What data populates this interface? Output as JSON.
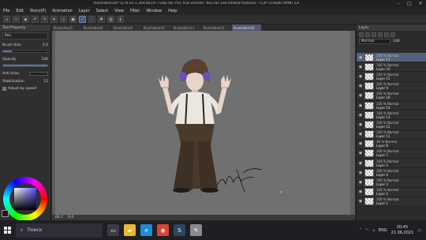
{
  "window": {
    "title": "Illustration16* (176.42 x 264.81cm 72dpi 66.7%)  Trial version: You can use limited features - CLIP STUDIO PAINT EX",
    "controls": [
      "–",
      "□",
      "✕"
    ]
  },
  "menu": [
    "File",
    "Edit",
    "Story(P)",
    "Animation",
    "Layer",
    "Select",
    "View",
    "Filter",
    "Window",
    "Help"
  ],
  "command_bar": [
    "new",
    "open",
    "save",
    "undo",
    "redo",
    "clear",
    "trans",
    "fill",
    "snap1",
    "snap2",
    "snap3",
    "ruler",
    "guide"
  ],
  "tool_property": {
    "header": "Tool Property",
    "brush_name": "Pen",
    "brush_size_label": "Brush Size",
    "brush_size_value": "5.0",
    "opacity_label": "Opacity",
    "opacity_value": "100",
    "opacity_level": 1.0,
    "size_level": 0.2,
    "antialias_label": "Anti-alias.",
    "stabilization_label": "Stabilization",
    "stabilization_value": "15",
    "adjust_speed_label": "Adjust by speed"
  },
  "doc_tabs": [
    "Illustration5",
    "Illustration8",
    "Illustration9",
    "Illustration10",
    "Illustration11",
    "Illustration12",
    "Illustration16"
  ],
  "active_tab_index": 6,
  "canvas_status": {
    "zoom": "66.7",
    "angle": "0.0"
  },
  "layer_panel": {
    "header": "Layer",
    "blend_mode": "Normal",
    "opacity": "100",
    "layers": [
      {
        "mode": "100 % Normal",
        "name": "Layer 17",
        "active": true
      },
      {
        "mode": "100 % Normal",
        "name": "Layer 10",
        "active": false
      },
      {
        "mode": "100 % Normal",
        "name": "Layer 15",
        "active": false
      },
      {
        "mode": "100 % Normal",
        "name": "Layer 9",
        "active": false
      },
      {
        "mode": "100 % Normal",
        "name": "Layer 16",
        "active": false
      },
      {
        "mode": "100 % Normal",
        "name": "Layer 14",
        "active": false
      },
      {
        "mode": "100 % Normal",
        "name": "Layer 13",
        "active": false
      },
      {
        "mode": "100 % Normal",
        "name": "Layer 12",
        "active": false
      },
      {
        "mode": "100 % Normal",
        "name": "Layer 11",
        "active": false
      },
      {
        "mode": "36 % Normal",
        "name": "Layer 8",
        "active": false
      },
      {
        "mode": "100 % Normal",
        "name": "Layer 7",
        "active": false
      },
      {
        "mode": "100 % Normal",
        "name": "Layer 5",
        "active": false
      },
      {
        "mode": "100 % Normal",
        "name": "Layer 4",
        "active": false
      },
      {
        "mode": "100 % Normal",
        "name": "Layer 3",
        "active": false
      },
      {
        "mode": "100 % Normal",
        "name": "Layer 2",
        "active": false
      },
      {
        "mode": "100 % Normal",
        "name": "Layer 1",
        "active": false
      }
    ]
  },
  "taskbar": {
    "search_placeholder": "Поиск",
    "apps": [
      {
        "name": "task-view",
        "color": "#3a3b44",
        "glyph": "▭"
      },
      {
        "name": "file-explorer",
        "color": "#e8b930",
        "glyph": "▰"
      },
      {
        "name": "edge",
        "color": "#1f8ad6",
        "glyph": "e"
      },
      {
        "name": "chrome",
        "color": "#d9432f",
        "glyph": "◉"
      },
      {
        "name": "steam",
        "color": "#2a475e",
        "glyph": "S"
      },
      {
        "name": "clip-studio",
        "color": "#8a8a8a",
        "glyph": "✎"
      }
    ],
    "language": "ENG",
    "time": "20:45",
    "date": "21.06.2021"
  },
  "colors": {
    "canvas": "#707070",
    "layer_selected": "#54617a",
    "accent": "#5574a8"
  }
}
